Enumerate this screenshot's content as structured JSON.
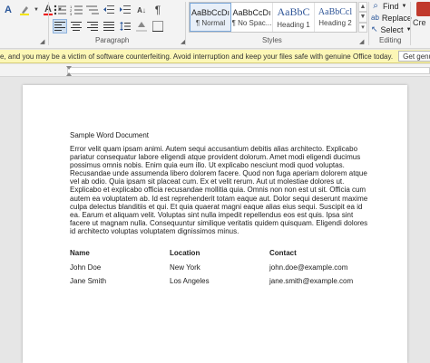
{
  "ribbon": {
    "groups": {
      "paragraph": "Paragraph",
      "styles": "Styles",
      "editing": "Editing"
    },
    "styles_gallery": [
      {
        "sample": "AaBbCcDı",
        "name": "¶ Normal",
        "selected": true,
        "kind": "normal"
      },
      {
        "sample": "AaBbCcDı",
        "name": "¶ No Spac...",
        "selected": false,
        "kind": "normal"
      },
      {
        "sample": "AaBbC",
        "name": "Heading 1",
        "selected": false,
        "kind": "heading"
      },
      {
        "sample": "AaBbCcl",
        "name": "Heading 2",
        "selected": false,
        "kind": "heading2"
      }
    ],
    "editing": {
      "find": "Find",
      "replace": "Replace",
      "select": "Select"
    },
    "create_label": "Cre"
  },
  "notification": {
    "text": "e, and you may be a victim of software counterfeiting. Avoid interruption and keep your files safe with genuine Office today.",
    "button": "Get genuine Office"
  },
  "document": {
    "title": "Sample Word Document",
    "body": "Error velit quam ipsam animi. Autem sequi accusantium debitis alias architecto. Explicabo pariatur consequatur labore eligendi atque provident dolorum. Amet modi eligendi ducimus possimus omnis nobis. Enim quia eum illo. Ut explicabo nesciunt modi quod voluptas. Recusandae unde assumenda libero dolorem facere. Quod non fuga aperiam dolorem atque vel ab odio. Quia ipsam sit placeat cum. Ex et velit rerum. Aut ut molestiae dolores ut. Explicabo et explicabo officia recusandae mollitia quia. Omnis non non est ut sit. Officia cum autem ea voluptatem ab. Id est reprehenderit totam eaque aut. Dolor sequi deserunt maxime culpa delectus blanditiis et qui. Et quia quaerat magni eaque alias eius sequi. Suscipit ea id ea. Earum et aliquam velit. Voluptas sint nulla impedit repellendus eos est quis. Ipsa sint facere ut magnam nulla. Consequuntur similique veritatis quidem quisquam. Eligendi dolores id architecto voluptas voluptatem dignissimos minus.",
    "table": {
      "headers": [
        "Name",
        "Location",
        "Contact"
      ],
      "rows": [
        [
          "John Doe",
          "New York",
          "john.doe@example.com"
        ],
        [
          "Jane Smith",
          "Los Angeles",
          "jane.smith@example.com"
        ]
      ]
    }
  },
  "colors": {
    "accent": "#2b579a",
    "notification_bg": "#fcf7b6",
    "heading_blue": "#2f5597"
  }
}
